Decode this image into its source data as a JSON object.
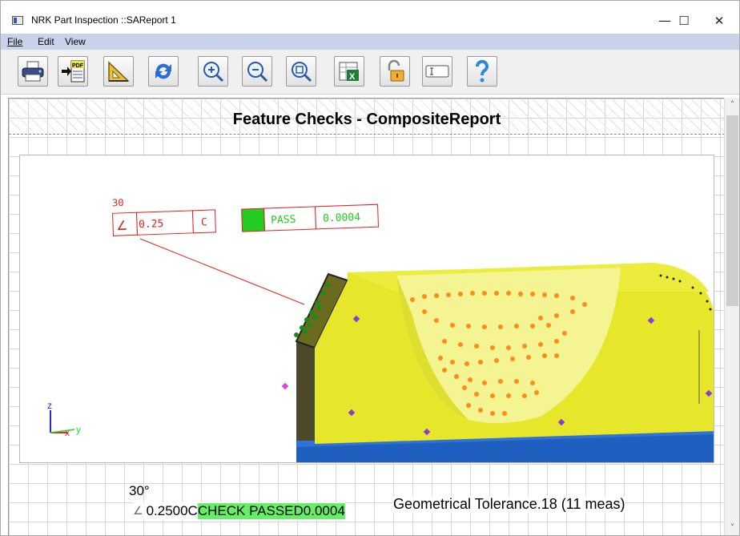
{
  "window": {
    "title": "NRK Part Inspection ::SAReport 1",
    "minimize_glyph": "—",
    "maximize_glyph": "☐",
    "close_glyph": "✕"
  },
  "menu": {
    "items": [
      {
        "label": "File"
      },
      {
        "label": "Edit"
      },
      {
        "label": "View"
      }
    ]
  },
  "toolbar": {
    "buttons": [
      {
        "icon": "printer-icon"
      },
      {
        "icon": "export-pdf-icon",
        "label": "PDF"
      },
      {
        "icon": "set-square-icon"
      },
      {
        "icon": "refresh-icon"
      },
      {
        "icon": "zoom-in-icon"
      },
      {
        "icon": "zoom-out-icon"
      },
      {
        "icon": "zoom-fit-icon"
      },
      {
        "icon": "export-excel-icon"
      },
      {
        "icon": "unlock-icon"
      },
      {
        "icon": "text-field-icon"
      },
      {
        "icon": "help-icon"
      }
    ]
  },
  "report": {
    "title": "Feature Checks - CompositeReport",
    "callout": {
      "angle": "30",
      "symbol": "∠",
      "tolerance": "0.25",
      "datum": "C",
      "status": "PASS",
      "deviation": "0.0004"
    },
    "axes": {
      "z": "z",
      "x": "x",
      "y": "y"
    },
    "caption": {
      "angle": "30°",
      "symbol": "∠",
      "tolerance_datum": "0.2500C",
      "result": "CHECK PASSED0.0004",
      "description": "Geometrical Tolerance.18 (11 meas)"
    }
  },
  "colors": {
    "menubar": "#c8d3ea",
    "callout_red": "#e02020",
    "pass_green": "#22cc22",
    "part_yellow": "#e6e62a",
    "base_blue": "#1f5fbf",
    "point_orange": "#ff8c1a"
  }
}
